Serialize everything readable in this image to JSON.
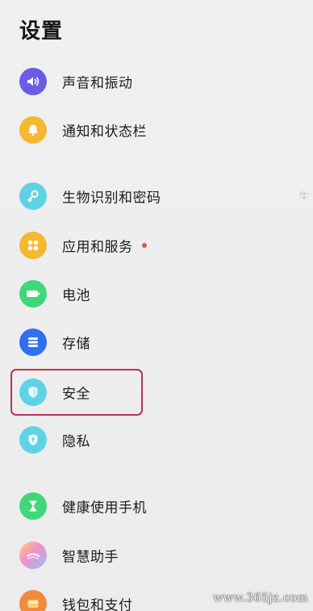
{
  "header": {
    "title": "设置"
  },
  "items": [
    {
      "id": "sound",
      "label": "声音和振动",
      "icon": "speaker-icon",
      "color": "#6b5ce7"
    },
    {
      "id": "notification",
      "label": "通知和状态栏",
      "icon": "bell-icon",
      "color": "#f5b82e"
    },
    {
      "id": "biometrics",
      "label": "生物识别和密码",
      "icon": "key-icon",
      "color": "#5fd3e3"
    },
    {
      "id": "apps",
      "label": "应用和服务",
      "icon": "apps-grid-icon",
      "color": "#f5b82e",
      "has_dot": true
    },
    {
      "id": "battery",
      "label": "电池",
      "icon": "battery-icon",
      "color": "#3fd77a"
    },
    {
      "id": "storage",
      "label": "存储",
      "icon": "storage-icon",
      "color": "#2f6ff0"
    },
    {
      "id": "security",
      "label": "安全",
      "icon": "shield-icon",
      "color": "#5fd3e3",
      "highlighted": true
    },
    {
      "id": "privacy",
      "label": "隐私",
      "icon": "privacy-shield-icon",
      "color": "#5fd3e3"
    },
    {
      "id": "digital-wellbeing",
      "label": "健康使用手机",
      "icon": "hourglass-icon",
      "color": "#3fd77a"
    },
    {
      "id": "assistant",
      "label": "智慧助手",
      "icon": "assistant-icon",
      "color": "#e58ac8"
    },
    {
      "id": "wallet",
      "label": "钱包和支付",
      "icon": "wallet-icon",
      "color": "#f08a3c"
    }
  ],
  "accent": {
    "highlight_border": "#b8334f",
    "notification_dot": "#e05545"
  },
  "watermark": "www.365jz.com"
}
